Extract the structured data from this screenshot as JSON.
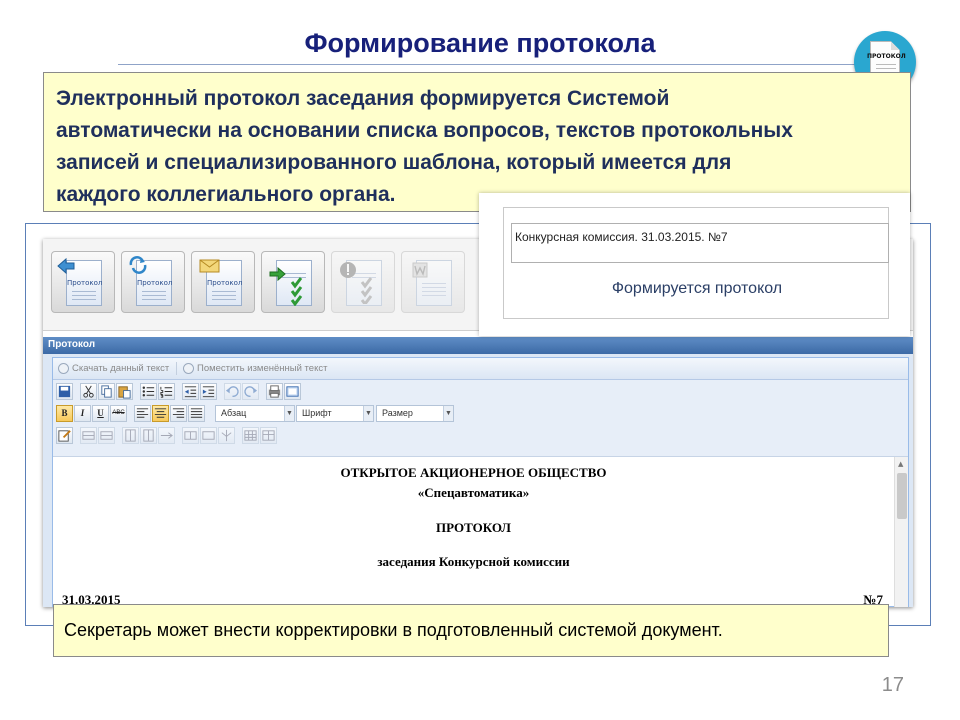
{
  "slide": {
    "title": "Формирование протокола",
    "page_number": "17"
  },
  "logo": {
    "label": "ПРОТОКОЛ",
    "color": "#2aa7d0"
  },
  "note_top": {
    "line1": "Электронный протокол заседания формируется Системой",
    "line2": "автоматически на основании списка вопросов, текстов протокольных",
    "line3": "записей и специализированного шаблона, который имеется для",
    "line4": "каждого коллегиального органа."
  },
  "toolbar": {
    "buttons": [
      {
        "label": "Протокол",
        "icon": "arrow-left-icon",
        "enabled": true
      },
      {
        "label": "Протокол",
        "icon": "refresh-icon",
        "enabled": true
      },
      {
        "label": "Протокол",
        "icon": "envelope-icon",
        "enabled": true
      },
      {
        "label": "",
        "icon": "arrow-checklist-icon",
        "enabled": true
      },
      {
        "label": "",
        "icon": "warning-checklist-icon",
        "enabled": false
      },
      {
        "label": "",
        "icon": "word-document-icon",
        "enabled": false
      }
    ]
  },
  "popup": {
    "field_value": "Конкурсная комиссия. 31.03.2015. №7",
    "status": "Формируется протокол"
  },
  "panel": {
    "title": "Протокол"
  },
  "editor": {
    "download_text": "Скачать данный текст",
    "upload_text": "Поместить изменённый текст",
    "format_bold": "B",
    "format_italic": "I",
    "format_underline": "U",
    "format_strike": "ABC",
    "paragraph_select": "Абзац",
    "font_select": "Шрифт",
    "size_select": "Размер"
  },
  "document": {
    "line1": "ОТКРЫТОЕ АКЦИОНЕРНОЕ ОБЩЕСТВО",
    "line2": "«Спецавтоматика»",
    "line3": "ПРОТОКОЛ",
    "line4": "заседания Конкурсной комиссии",
    "date": "31.03.2015",
    "number": "№7"
  },
  "note_bottom": {
    "text": "Секретарь может внести корректировки в подготовленный системой документ."
  },
  "colors": {
    "title": "#17207a",
    "note_background": "#ffffcc",
    "note_text": "#1f2f5c",
    "panel_header": "#4a78b4",
    "frame_border": "#5b7fb7"
  }
}
